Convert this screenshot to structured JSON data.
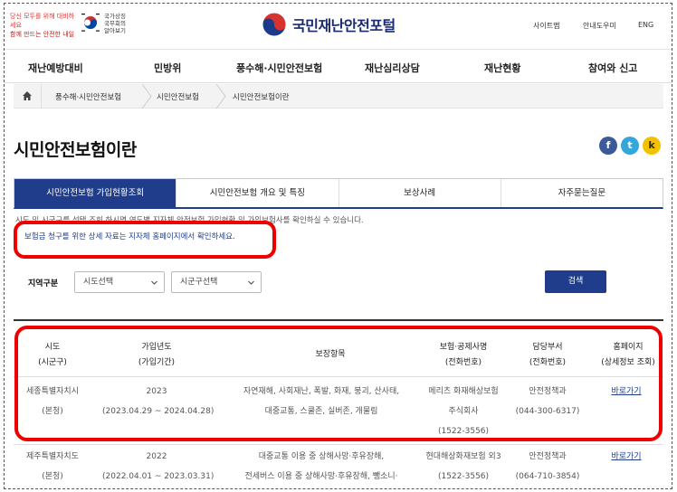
{
  "header": {
    "slogan_line1": "당신 모두를 위해 대비하세요",
    "slogan_line2": "함께 만드는 안전한 내일",
    "gov_lines": [
      "국가상징",
      "국무회의",
      "알아보기"
    ],
    "brand": "국민재난안전포털",
    "utility": [
      "사이트맵",
      "안내도우미",
      "ENG"
    ]
  },
  "nav": [
    "재난예방대비",
    "민방위",
    "풍수해·시민안전보험",
    "재난심리상담",
    "재난현황",
    "참여와 신고"
  ],
  "breadcrumb": [
    "풍수해·시민안전보험",
    "시민안전보험",
    "시민안전보험이란"
  ],
  "page_title": "시민안전보험이란",
  "share": {
    "facebook": "f",
    "twitter": "t",
    "kakao": "k"
  },
  "tabs": [
    "시민안전보험 가입현황조회",
    "시민안전보험 개요 및 특징",
    "보상사례",
    "자주묻는질문"
  ],
  "desc1": "시도 및 시군구를 선택 조회 하시면 연도별 지자체 안전보험 가입현황 및 가입보험사를 확인하실 수 있습니다.",
  "desc2": "보험금 청구를 위한 상세 자료는 지자체 홈페이지에서 확인하세요.",
  "filter": {
    "label": "지역구분",
    "sido": "시도선택",
    "sigungu": "시군구선택",
    "search": "검색"
  },
  "table": {
    "headers": [
      [
        "시도",
        "(시군구)"
      ],
      [
        "가입년도",
        "(가입기간)"
      ],
      [
        "보장항목"
      ],
      [
        "보험·공제사명",
        "(전화번호)"
      ],
      [
        "담당부서",
        "(전화번호)"
      ],
      [
        "홈페이지",
        "(상세정보 조회)"
      ]
    ],
    "rows": [
      {
        "region": [
          "세종특별자치시",
          "(본청)"
        ],
        "year": [
          "2023",
          "(2023.04.29 ~ 2024.04.28)"
        ],
        "coverage": [
          "자연재해, 사회재난, 폭발, 화재, 붕괴, 산사태,",
          "대중교통, 스쿨존, 실버존, 개물림"
        ],
        "insurer": [
          "메리츠 화재해상보험",
          "주식회사",
          "(1522-3556)"
        ],
        "dept": [
          "안전정책과",
          "(044-300-6317)"
        ],
        "link": "바로가기"
      },
      {
        "region": [
          "제주특별자치도",
          "(본청)"
        ],
        "year": [
          "2022",
          "(2022.04.01 ~ 2023.03.31)"
        ],
        "coverage": [
          "대중교통 이용 중 상해사망·후유장해,",
          "전세버스 이용 중 상해사망·후유장해, 뺑소니·"
        ],
        "insurer": [
          "현대해상화재보험 외3",
          "(1522-3556)"
        ],
        "dept": [
          "안전정책과",
          "(064-710-3854)"
        ],
        "link": "바로가기"
      }
    ]
  }
}
